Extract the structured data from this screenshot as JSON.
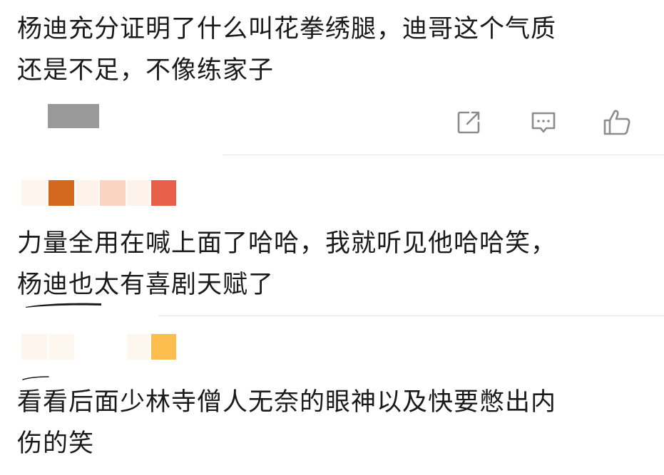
{
  "comments": [
    {
      "text_lines": [
        "杨迪充分证明了什么叫花拳绣腿，迪哥这个气质",
        "还是不足，不像练家子"
      ],
      "actions": {
        "share_icon": "share-icon",
        "reply_icon": "comment-icon",
        "like_icon": "thumbs-up-icon"
      }
    },
    {
      "text_lines": [
        "力量全用在喊上面了哈哈，我就听见他哈哈笑，",
        "杨迪也太有喜剧天赋了"
      ]
    },
    {
      "text_lines": [
        "看看后面少林寺僧人无奈的眼神以及快要憋出内",
        "伤的笑"
      ]
    }
  ],
  "colors": {
    "text": "#1a1a1a",
    "icon": "#8c8c8c",
    "divider": "#e6e6e6",
    "censor_gray": "#999999",
    "censor_orange": "#d2691e",
    "censor_peach": "#fad4c0",
    "censor_cream": "#fdf3ea",
    "censor_red": "#e9604a",
    "censor_yellow": "#fbbd4e"
  }
}
